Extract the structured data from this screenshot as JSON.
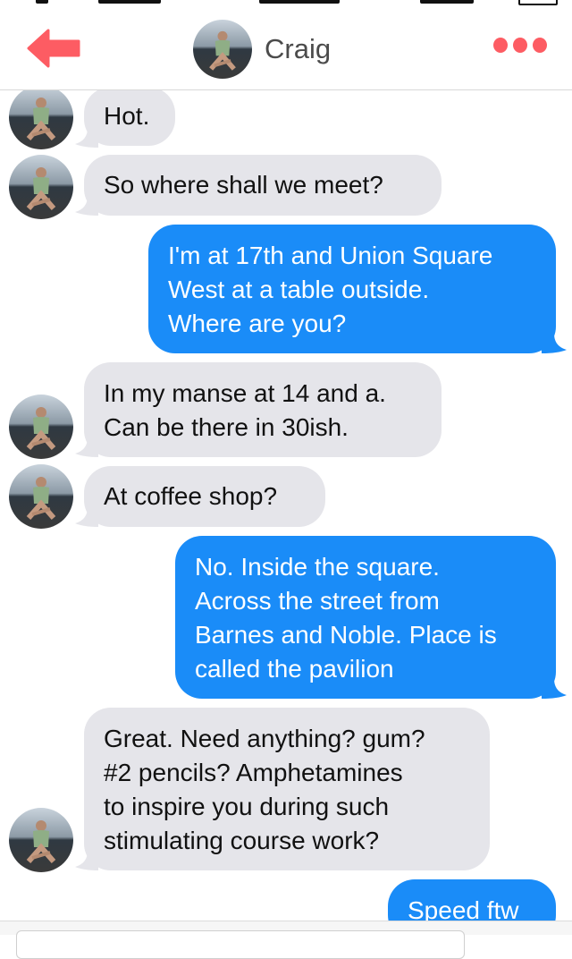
{
  "header": {
    "contact_name": "Craig",
    "back_icon": "back-arrow-icon",
    "more_icon": "more-dots-icon"
  },
  "colors": {
    "accent": "#fd5c63",
    "incoming_bubble": "#e5e5ea",
    "outgoing_bubble": "#1a8cf8"
  },
  "messages": [
    {
      "direction": "incoming",
      "lines": [
        "Hot."
      ]
    },
    {
      "direction": "incoming",
      "lines": [
        "So where shall we meet?"
      ]
    },
    {
      "direction": "outgoing",
      "lines": [
        "I'm at 17th and Union Square",
        "West at a table outside.",
        "Where are you?"
      ]
    },
    {
      "direction": "incoming",
      "lines": [
        "In my manse at 14 and a.",
        "Can be there in 30ish."
      ]
    },
    {
      "direction": "incoming",
      "lines": [
        "At coffee shop?"
      ]
    },
    {
      "direction": "outgoing",
      "lines": [
        "No. Inside the square.",
        "Across the street from",
        "Barnes and Noble. Place is",
        "called the pavilion"
      ]
    },
    {
      "direction": "incoming",
      "lines": [
        "Great. Need anything? gum?",
        "#2 pencils? Amphetamines",
        "to inspire you during such",
        "stimulating course work?"
      ]
    },
    {
      "direction": "outgoing",
      "lines": [
        "Speed ftw"
      ]
    }
  ]
}
